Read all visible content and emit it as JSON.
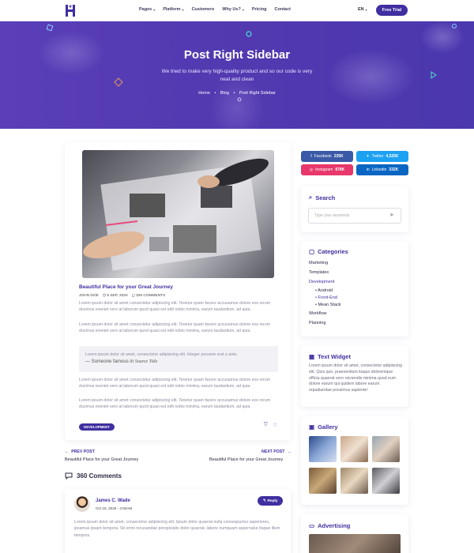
{
  "nav": {
    "menu": [
      "Pages",
      "Platform",
      "Customers",
      "Why Us?",
      "Pricing",
      "Contact"
    ],
    "has_dropdown": [
      true,
      true,
      false,
      true,
      false,
      false
    ],
    "lang": "EN",
    "cta": "Free Trial"
  },
  "hero": {
    "title": "Post Right Sidebar",
    "subtitle": "We tried to make very high-quality product and so our code is very neat and clean",
    "breadcrumb": [
      "Home",
      "Blog",
      "Post Right Sidebar"
    ]
  },
  "post": {
    "title": "Beautiful Place for your Great Journey",
    "author": "JOHN DOE",
    "date": "6 SEP, 2020",
    "comments": "326 COMMENTS",
    "para1": "Lorem ipsum dolor sit amet consectetur adipiscing elit. Tenetur quam facere accusamus dolore eos rerum ducimus eveniet vero at laborum quod quasi est edit nobis minima, earum laudantium, ad quia.",
    "para2": "Lorem ipsum dolor sit amet consectetur adipiscing elit. Tenetur quam facere accusamus dolore eos rerum ducimus eveniet vero at laborum quod quasi est edit nobis minima, earum laudantium, ad quia.",
    "quote": "Lorem ipsum dolor sit amet, consectetur adipisicing elit. Integer posuere erat a ante.",
    "quote_author": "— Someone famous in",
    "quote_source": "Source Title",
    "para3": "Lorem ipsum dolor sit amet consectetur adipiscing elit. Tenetur quam facere accusamus dolore eos rerum ducimus eveniet vero at laborum quod quasi est edit nobis minima, earum laudantium, ad quia.",
    "para4": "Lorem ipsum dolor sit amet consectetur adipiscing elit. Tenetur quam facere accusamus dolore eos rerum ducimus eveniet vero at laborum quod quasi est edit nobis minima, earum laudantium, ad quia.",
    "tag": "DEVELOPMENT"
  },
  "pager": {
    "prev_label": "PREV POST",
    "prev_title": "Beautiful Place for your Great Journey",
    "next_label": "NEXT POST",
    "next_title": "Beautiful Place for your Great Journey"
  },
  "comments": {
    "heading": "360 Comments",
    "items": [
      {
        "name": "James C. Wade",
        "date": "Oct 18, 2020 - 4:00AM",
        "reply": "Reply",
        "text": "Lorem ipsum dolor sit amet, consectetur adipisicing elit. Ipsum dolor quaerat nulla consequuntur asperiores, ipsamus ipsam tempora. Sit omni recusandae perspiciatis dolor quaerat, labore numquam aspernatur itaque illum tempora."
      }
    ]
  },
  "sidebar": {
    "social": [
      {
        "name": "Facebook",
        "count": "235K",
        "color": "#3a5aa8"
      },
      {
        "name": "Twitter",
        "count": "4,525K",
        "color": "#1da1f2"
      },
      {
        "name": "Instagram",
        "count": "878K",
        "color": "#e8376a"
      },
      {
        "name": "Linkedin",
        "count": "332K",
        "color": "#0a66c2"
      }
    ],
    "search_title": "Search",
    "search_placeholder": "Type your keywords",
    "categories_title": "Categories",
    "categories": [
      "Marketing",
      "Templates",
      "Development",
      "Android",
      "Front-End",
      "Mean Stack",
      "Workflow",
      "Planning"
    ],
    "text_title": "Text Widget",
    "text_body": "Lorem ipsum dolor sit amet, consectetur adipisicing elit. Quis quo, praesentium itaque doloremque officia quaerat vero reiciendis minima quod eum dolore earum qui quidem labore earum repudiandae possimus sapiente!",
    "gallery_title": "Gallery",
    "advertising_title": "Advertising"
  },
  "colors": {
    "primary": "#3f2fa0",
    "hero": "#5239b0",
    "muted_text": "#8a8aa0"
  }
}
